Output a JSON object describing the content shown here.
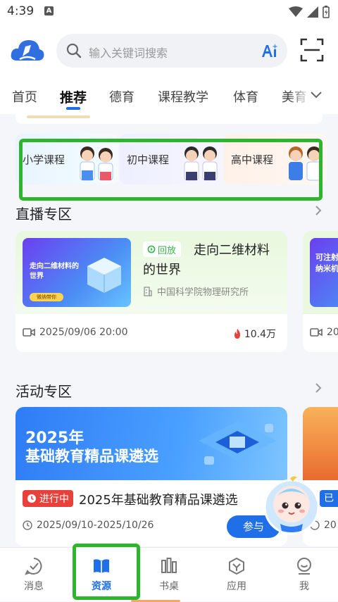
{
  "status_bar": {
    "time": "4:39",
    "notification_badge": "A"
  },
  "search": {
    "placeholder": "输入关键词搜索"
  },
  "tabs": [
    {
      "label": "首页"
    },
    {
      "label": "推荐"
    },
    {
      "label": "德育"
    },
    {
      "label": "课程教学"
    },
    {
      "label": "体育"
    },
    {
      "label": "美育"
    }
  ],
  "active_tab": "推荐",
  "courses": [
    {
      "label": "小学课程"
    },
    {
      "label": "初中课程"
    },
    {
      "label": "高中课程"
    }
  ],
  "live_section": {
    "title": "直播专区",
    "card": {
      "thumb_title": "走向二维材料的世界",
      "badge": "回放",
      "title": "走向二维材料的世界",
      "org": "中国科学院物理研究所",
      "datetime": "2025/09/06 20:00",
      "views": "10.4万"
    },
    "next_card": {
      "thumb_title": "可注射纳米机",
      "datetime": "20"
    }
  },
  "activity_section": {
    "title": "活动专区",
    "card": {
      "banner_year": "2025年",
      "banner_title": "基础教育精品课遴选",
      "status": "进行中",
      "name": "2025年基础教育精品课遴选",
      "dates": "2025/09/10-2025/10/26",
      "action": "参与"
    },
    "next_card": {
      "status": "已",
      "dates": "20"
    }
  },
  "bottom_nav": [
    {
      "label": "消息",
      "icon": "message-icon"
    },
    {
      "label": "资源",
      "icon": "book-icon"
    },
    {
      "label": "书桌",
      "icon": "bookshelf-icon"
    },
    {
      "label": "应用",
      "icon": "apps-icon"
    },
    {
      "label": "我",
      "icon": "profile-icon"
    }
  ],
  "active_nav": "资源",
  "colors": {
    "accent": "#1f6fe8",
    "highlight": "#2db52d",
    "live_tint": "#e9f8de",
    "status_red": "#e8413b"
  }
}
